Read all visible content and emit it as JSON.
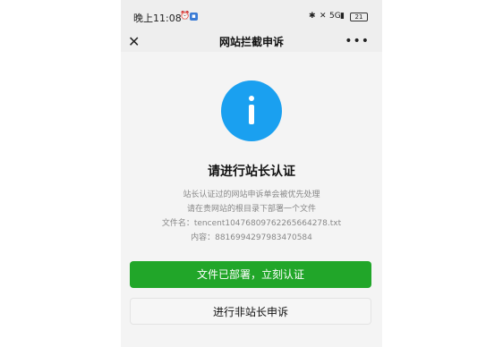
{
  "status_bar": {
    "time": "晚上11:08",
    "network": "5G",
    "battery": "21"
  },
  "nav": {
    "title": "网站拦截申诉",
    "close_icon": "close-icon",
    "more_icon": "more-icon"
  },
  "main": {
    "heading": "请进行站长认证",
    "line1": "站长认证过的网站申诉单会被优先处理",
    "line2": "请在贵网站的根目录下部署一个文件",
    "filename_line": "文件名：tencent10476809762265664278.txt",
    "content_line": "内容：8816994297983470584"
  },
  "buttons": {
    "deployed": "文件已部署，立刻认证",
    "non_owner": "进行非站长申诉"
  },
  "colors": {
    "accent_blue": "#1aa0f0",
    "primary_green": "#21a629"
  }
}
